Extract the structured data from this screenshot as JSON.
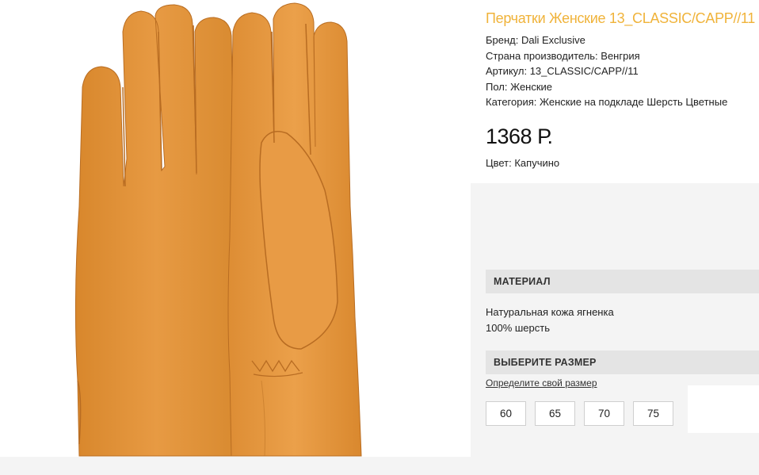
{
  "product": {
    "title": "Перчатки Женские 13_CLASSIC/CAPP//11",
    "brand": "Бренд: Dali Exclusive",
    "country": "Страна производитель: Венгрия",
    "article": "Артикул: 13_CLASSIC/CAPP//11",
    "gender": "Пол: Женские",
    "category": "Категория: Женские на подкладе Шерсть Цветные",
    "price": "1368 Р.",
    "color": "Цвет: Капучино",
    "image_icon": "glove-image"
  },
  "material": {
    "heading": "МАТЕРИАЛ",
    "lines": [
      "Натуральная кожа ягненка",
      "100% шерсть"
    ]
  },
  "size": {
    "heading": "ВЫБЕРИТЕ РАЗМЕР",
    "link": "Определите свой размер",
    "options": [
      "60",
      "65",
      "70",
      "75"
    ]
  },
  "colors": {
    "title": "#f0b33a",
    "glove": "#e0963a",
    "glove_shadow": "#c9782a",
    "section_bg": "#e4e4e4"
  }
}
